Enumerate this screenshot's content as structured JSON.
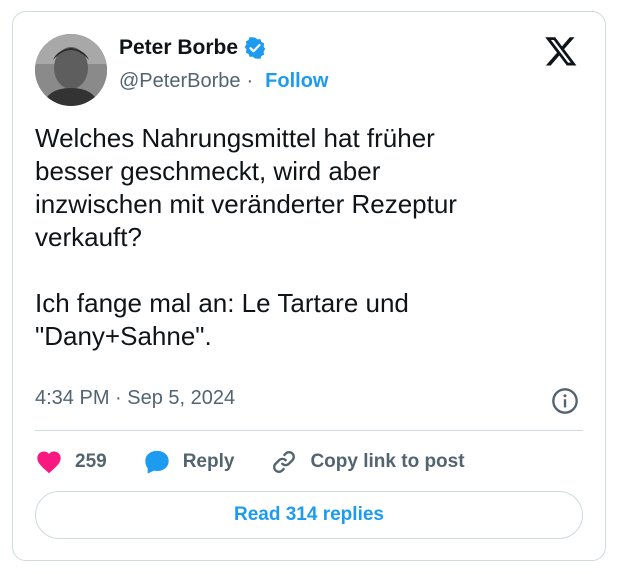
{
  "author": {
    "display_name": "Peter Borbe",
    "handle": "@PeterBorbe",
    "separator": "·",
    "follow_label": "Follow",
    "avatar": "profile-photo"
  },
  "tweet": {
    "text": "Welches Nahrungsmittel hat früher\nbesser geschmeckt, wird aber\ninzwischen mit veränderter Rezeptur\nverkauft?\n\nIch fange mal an: Le Tartare und\n\"Dany+Sahne\".",
    "timestamp": "4:34 PM · Sep 5, 2024"
  },
  "actions": {
    "like_count": "259",
    "reply_label": "Reply",
    "copy_label": "Copy link to post"
  },
  "read_replies_label": "Read 314 replies",
  "colors": {
    "accent": "#1d9bf0",
    "heart": "#f91880",
    "text": "#0f1419",
    "muted": "#536471",
    "border": "#cfd9de"
  },
  "icons": [
    "verified-badge-icon",
    "x-logo-icon",
    "info-icon",
    "heart-icon",
    "reply-bubble-icon",
    "link-icon"
  ]
}
